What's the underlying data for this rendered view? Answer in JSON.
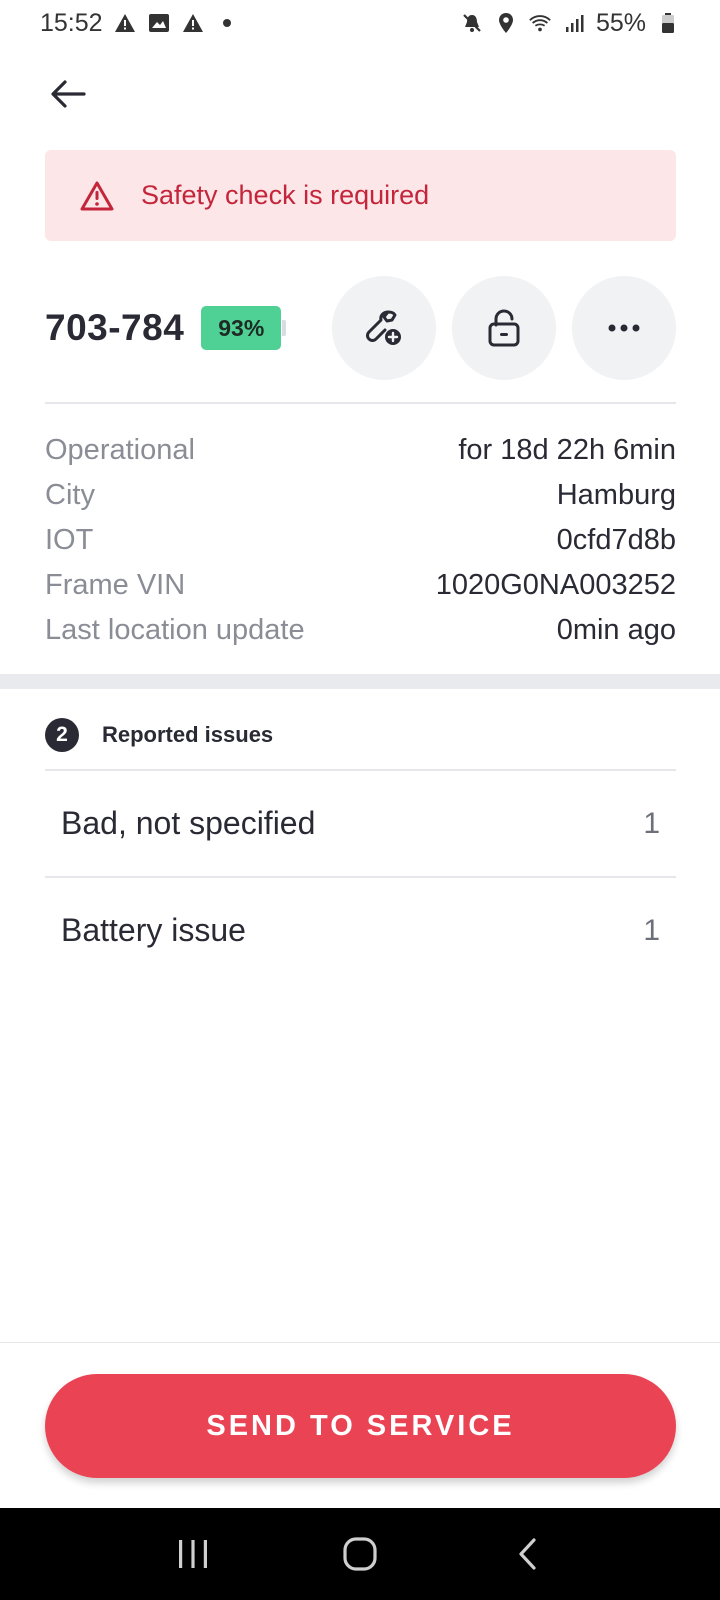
{
  "status_bar": {
    "time": "15:52",
    "battery_percent": "55%",
    "left_icons": [
      "warning-icon",
      "image-icon",
      "warning-icon",
      "dot-icon"
    ],
    "right_icons": [
      "mute-icon",
      "location-icon",
      "wifi-icon",
      "signal-icon",
      "battery-icon"
    ]
  },
  "alert": {
    "text": "Safety check is required",
    "color": "#c4253a",
    "background": "#fce6e8"
  },
  "vehicle": {
    "id": "703-784",
    "battery": "93%",
    "battery_color": "#4fd196"
  },
  "actions": [
    {
      "name": "repair",
      "icon": "wrench-plus-icon"
    },
    {
      "name": "lock",
      "icon": "lock-icon"
    },
    {
      "name": "more",
      "icon": "more-icon"
    }
  ],
  "info": [
    {
      "label": "Operational",
      "value": "for 18d 22h 6min"
    },
    {
      "label": "City",
      "value": "Hamburg"
    },
    {
      "label": "IOT",
      "value": "0cfd7d8b"
    },
    {
      "label": "Frame VIN",
      "value": "1020G0NA003252"
    },
    {
      "label": "Last location update",
      "value": "0min ago"
    }
  ],
  "issues": {
    "count": "2",
    "title": "Reported issues",
    "items": [
      {
        "name": "Bad, not specified",
        "count": "1"
      },
      {
        "name": "Battery issue",
        "count": "1"
      }
    ]
  },
  "cta": {
    "label": "SEND TO SERVICE",
    "color": "#ea4454"
  },
  "nav_bar": {
    "buttons": [
      "recents-icon",
      "home-icon",
      "back-icon"
    ]
  }
}
